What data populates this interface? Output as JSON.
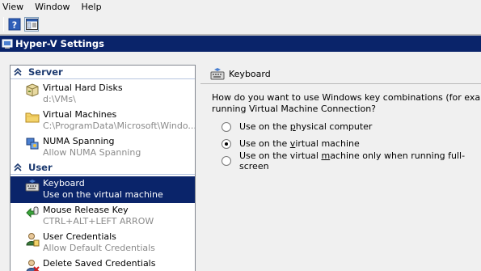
{
  "menubar": {
    "items": [
      "View",
      "Window",
      "Help"
    ]
  },
  "toolbar": {
    "buttons": [
      "help-icon",
      "console-pane-icon"
    ]
  },
  "window": {
    "title": "Hyper-V Settings"
  },
  "tree": {
    "sections": [
      {
        "label": "Server",
        "items": [
          {
            "name": "Virtual Hard Disks",
            "sub": "d:\\VMs\\",
            "icon": "hard-disk-icon"
          },
          {
            "name": "Virtual Machines",
            "sub": "C:\\ProgramData\\Microsoft\\Windo...",
            "icon": "folder-icon"
          },
          {
            "name": "NUMA Spanning",
            "sub": "Allow NUMA Spanning",
            "icon": "numa-icon"
          }
        ]
      },
      {
        "label": "User",
        "items": [
          {
            "name": "Keyboard",
            "sub": "Use on the virtual machine",
            "icon": "keyboard-icon",
            "selected": true
          },
          {
            "name": "Mouse Release Key",
            "sub": "CTRL+ALT+LEFT ARROW",
            "icon": "mouse-release-icon"
          },
          {
            "name": "User Credentials",
            "sub": "Allow Default Credentials",
            "icon": "user-credentials-icon"
          },
          {
            "name": "Delete Saved Credentials",
            "sub": "",
            "icon": "delete-credentials-icon"
          }
        ]
      }
    ]
  },
  "panel": {
    "header": "Keyboard",
    "question_line1": "How do you want to use Windows key combinations (for example, ALT",
    "question_line2": "running Virtual Machine Connection?",
    "options": [
      {
        "pre": "Use on the ",
        "u": "p",
        "post": "hysical computer",
        "checked": false
      },
      {
        "pre": "Use on the ",
        "u": "v",
        "post": "irtual machine",
        "checked": true
      },
      {
        "pre": "Use on the virtual ",
        "u": "m",
        "post": "achine only when running full-screen",
        "checked": false
      }
    ]
  },
  "colors": {
    "selection": "#0a246a",
    "section_header": "#1c3a70",
    "dialog_bg": "#f0f0f0"
  }
}
